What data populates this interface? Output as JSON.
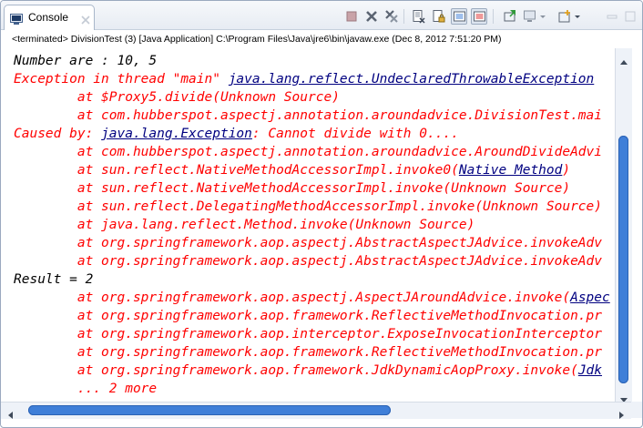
{
  "tab": {
    "label": "Console",
    "icon": "console-icon",
    "close_icon": "close-icon"
  },
  "toolbar": {
    "buttons": [
      {
        "name": "terminate-button",
        "icon": "stop-square-icon"
      },
      {
        "name": "remove-launch-button",
        "icon": "remove-x-icon"
      },
      {
        "name": "remove-all-terminated-button",
        "icon": "remove-all-icon"
      },
      {
        "name": "clear-console-button",
        "icon": "clear-console-icon"
      },
      {
        "name": "scroll-lock-button",
        "icon": "scroll-lock-icon"
      },
      {
        "name": "show-on-stdout-button",
        "icon": "stdout-icon"
      },
      {
        "name": "show-on-stderr-button",
        "icon": "stderr-icon"
      },
      {
        "name": "pin-console-button",
        "icon": "pin-icon"
      },
      {
        "name": "display-selected-console-button",
        "icon": "monitor-icon"
      },
      {
        "name": "open-console-button",
        "icon": "open-console-icon"
      }
    ]
  },
  "status_line": "<terminated> DivisionTest (3) [Java Application] C:\\Program Files\\Java\\jre6\\bin\\javaw.exe (Dec 8, 2012 7:51:20 PM)",
  "output": {
    "lines": [
      {
        "kind": "out",
        "text": "Number are : 10, 5"
      },
      {
        "kind": "err",
        "pre": "Exception in thread \"main\" ",
        "link": "java.lang.reflect.UndeclaredThrowableException",
        "post": ""
      },
      {
        "kind": "err",
        "pre": "\tat $Proxy5.divide(Unknown Source)",
        "link": "",
        "post": ""
      },
      {
        "kind": "err",
        "pre": "\tat com.hubberspot.aspectj.annotation.aroundadvice.DivisionTest.mai",
        "link": "",
        "post": ""
      },
      {
        "kind": "err",
        "pre": "Caused by: ",
        "link": "java.lang.Exception",
        "post": ": Cannot divide with 0...."
      },
      {
        "kind": "err",
        "pre": "\tat com.hubberspot.aspectj.annotation.aroundadvice.AroundDivideAdvi",
        "link": "",
        "post": ""
      },
      {
        "kind": "err",
        "pre": "\tat sun.reflect.NativeMethodAccessorImpl.invoke0(",
        "link": "Native Method",
        "post": ")"
      },
      {
        "kind": "err",
        "pre": "\tat sun.reflect.NativeMethodAccessorImpl.invoke(Unknown Source)",
        "link": "",
        "post": ""
      },
      {
        "kind": "err",
        "pre": "\tat sun.reflect.DelegatingMethodAccessorImpl.invoke(Unknown Source)",
        "link": "",
        "post": ""
      },
      {
        "kind": "err",
        "pre": "\tat java.lang.reflect.Method.invoke(Unknown Source)",
        "link": "",
        "post": ""
      },
      {
        "kind": "err",
        "pre": "\tat org.springframework.aop.aspectj.AbstractAspectJAdvice.invokeAdv",
        "link": "",
        "post": ""
      },
      {
        "kind": "err",
        "pre": "\tat org.springframework.aop.aspectj.AbstractAspectJAdvice.invokeAdv",
        "link": "",
        "post": ""
      },
      {
        "kind": "out",
        "text": "Result = 2"
      },
      {
        "kind": "err",
        "pre": "\tat org.springframework.aop.aspectj.AspectJAroundAdvice.invoke(",
        "link": "Aspec",
        "post": ""
      },
      {
        "kind": "err",
        "pre": "\tat org.springframework.aop.framework.ReflectiveMethodInvocation.pr",
        "link": "",
        "post": ""
      },
      {
        "kind": "err",
        "pre": "\tat org.springframework.aop.interceptor.ExposeInvocationInterceptor",
        "link": "",
        "post": ""
      },
      {
        "kind": "err",
        "pre": "\tat org.springframework.aop.framework.ReflectiveMethodInvocation.pr",
        "link": "",
        "post": ""
      },
      {
        "kind": "err",
        "pre": "\tat org.springframework.aop.framework.JdkDynamicAopProxy.invoke(",
        "link": "Jdk",
        "post": ""
      },
      {
        "kind": "err",
        "pre": "\t... 2 more",
        "link": "",
        "post": ""
      }
    ]
  },
  "colors": {
    "stderr": "#ff0000",
    "stdout": "#000000",
    "link": "#000080",
    "scrollbar_thumb": "#3f7fd8"
  }
}
